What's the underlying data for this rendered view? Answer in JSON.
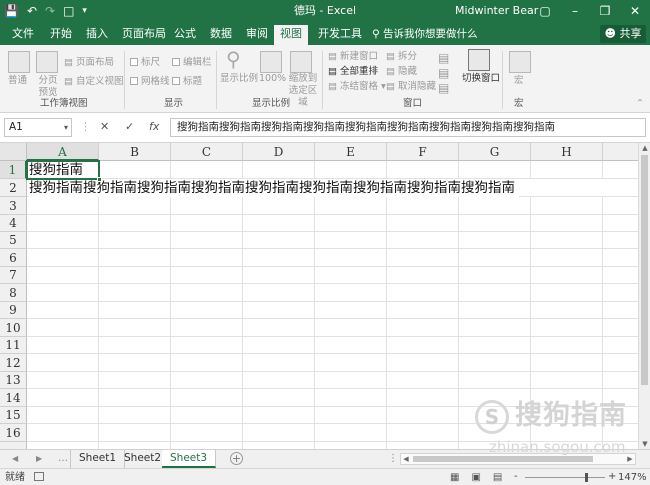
{
  "window": {
    "doc_title": "德玛 - Excel",
    "user": "Midwinter Bear",
    "minimize": "–",
    "restore": "❐",
    "close": "✕"
  },
  "qat": [
    "save-icon",
    "undo-icon",
    "redo-icon",
    "new-doc-icon",
    "customize-icon"
  ],
  "tabs": [
    {
      "label": "文件",
      "active": false
    },
    {
      "label": "开始",
      "active": false
    },
    {
      "label": "插入",
      "active": false
    },
    {
      "label": "页面布局",
      "active": false
    },
    {
      "label": "公式",
      "active": false
    },
    {
      "label": "数据",
      "active": false
    },
    {
      "label": "审阅",
      "active": false
    },
    {
      "label": "视图",
      "active": true
    },
    {
      "label": "开发工具",
      "active": false
    }
  ],
  "tell_me": "告诉我你想要做什么",
  "share": "共享",
  "ribbon": {
    "views": {
      "normal": "普通",
      "page_break": "分页\n预览",
      "page_layout": "页面布局",
      "custom_views": "自定义视图",
      "group": "工作簿视图"
    },
    "show": {
      "ruler": "标尺",
      "formula_bar": "编辑栏",
      "gridlines": "网格线",
      "headings": "标题",
      "group": "显示"
    },
    "zoom": {
      "zoom": "显示比例",
      "hundred": "100%",
      "zoom_selection": "缩放到\n选定区域",
      "group": "显示比例"
    },
    "window": {
      "new_window": "新建窗口",
      "arrange_all": "全部重排",
      "freeze": "冻结窗格",
      "split": "拆分",
      "hide": "隐藏",
      "unhide": "取消隐藏",
      "switch": "切换窗口",
      "group": "窗口"
    },
    "macros": {
      "macro": "宏",
      "group": "宏"
    }
  },
  "formula_bar": {
    "name_box": "A1",
    "cancel": "✕",
    "enter": "✓",
    "fx": "fx",
    "content": "搜狗指南搜狗指南搜狗指南搜狗指南搜狗指南搜狗指南搜狗指南搜狗指南搜狗指南"
  },
  "columns": [
    "A",
    "B",
    "C",
    "D",
    "E",
    "F",
    "G",
    "H"
  ],
  "rows": [
    "1",
    "2",
    "3",
    "4",
    "5",
    "6",
    "7",
    "8",
    "9",
    "10",
    "11",
    "12",
    "13",
    "14",
    "15",
    "16"
  ],
  "cells": {
    "A1": "搜狗指南",
    "A2": "搜狗指南搜狗指南搜狗指南搜狗指南搜狗指南搜狗指南搜狗指南搜狗指南搜狗指南"
  },
  "sheets": [
    {
      "name": "Sheet1",
      "active": false
    },
    {
      "name": "Sheet2",
      "active": false
    },
    {
      "name": "Sheet3",
      "active": true
    }
  ],
  "add_sheet": "+",
  "status": {
    "ready": "就绪",
    "minus": "-",
    "plus": "+",
    "zoom": "147%"
  },
  "watermark": {
    "logo": "S",
    "text": "搜狗指南",
    "url": "zhinan.sogou.com"
  },
  "colors": {
    "brand": "#217346"
  }
}
